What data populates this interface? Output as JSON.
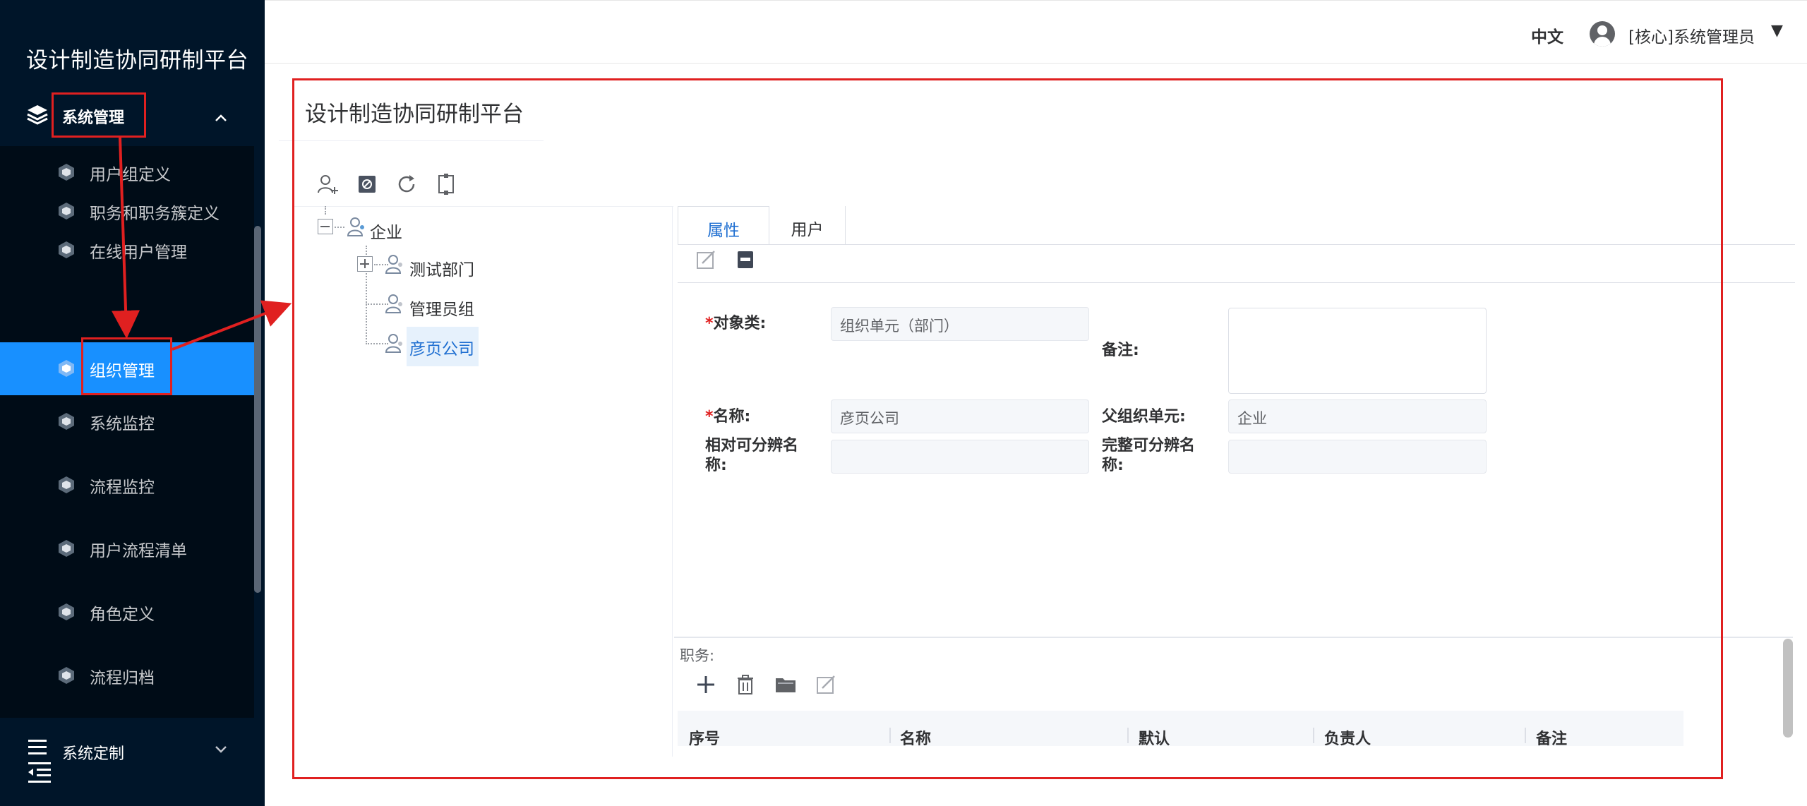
{
  "sidebar": {
    "app_title": "设计制造协同研制平台",
    "group": {
      "label": "系统管理",
      "icon": "layers-icon",
      "chevron": "⌃"
    },
    "items": [
      {
        "label": "用户组定义",
        "icon": "cube-icon",
        "active": false
      },
      {
        "label": "职务和职务簇定义",
        "icon": "cube-icon",
        "active": false
      },
      {
        "label": "在线用户管理",
        "icon": "cube-icon",
        "active": false
      },
      {
        "label": "组织管理",
        "icon": "cube-icon",
        "active": true
      },
      {
        "label": "系统监控",
        "icon": "cube-icon",
        "active": false
      },
      {
        "label": "流程监控",
        "icon": "cube-icon",
        "active": false
      },
      {
        "label": "用户流程清单",
        "icon": "cube-icon",
        "active": false
      },
      {
        "label": "角色定义",
        "icon": "cube-icon",
        "active": false
      },
      {
        "label": "流程归档",
        "icon": "cube-icon",
        "active": false
      }
    ],
    "group2": {
      "label": "系统定制",
      "icon": "list-icon",
      "chevron": "⌄"
    },
    "collapse_icon": "menu-fold-icon"
  },
  "header": {
    "language": "中文",
    "user": "[核心]系统管理员",
    "caret": "▼"
  },
  "panel": {
    "title": "设计制造协同研制平台",
    "tree_toolbar": [
      "add-user-icon",
      "disable-icon",
      "refresh-icon",
      "fit-icon"
    ],
    "tree": {
      "root": "企业",
      "children": [
        "测试部门",
        "管理员组",
        "彦页公司"
      ],
      "selected": "彦页公司"
    },
    "tabs": [
      "属性",
      "用户"
    ],
    "form": {
      "object_class_label": "对象类:",
      "object_class_value": "组织单元（部门）",
      "remark_label": "备注:",
      "name_label": "名称:",
      "name_value": "彦页公司",
      "parent_label": "父组织单元:",
      "parent_value": "企业",
      "relative_name_label_1": "相对可分辨名",
      "relative_name_label_2": "称:",
      "full_name_label_1": "完整可分辨名",
      "full_name_label_2": "称:",
      "required_mark": "*"
    },
    "duties": {
      "label": "职务:",
      "toolbar": [
        "plus-icon",
        "delete-icon",
        "folder-icon",
        "edit-icon"
      ],
      "columns": [
        "序号",
        "名称",
        "默认",
        "负责人",
        "备注"
      ]
    }
  },
  "colors": {
    "sidebar_bg": "#001529",
    "submenu_bg": "#000c17",
    "active_item": "#1890ff",
    "annotation_red": "#e02020",
    "link_blue": "#1f6fd1"
  }
}
